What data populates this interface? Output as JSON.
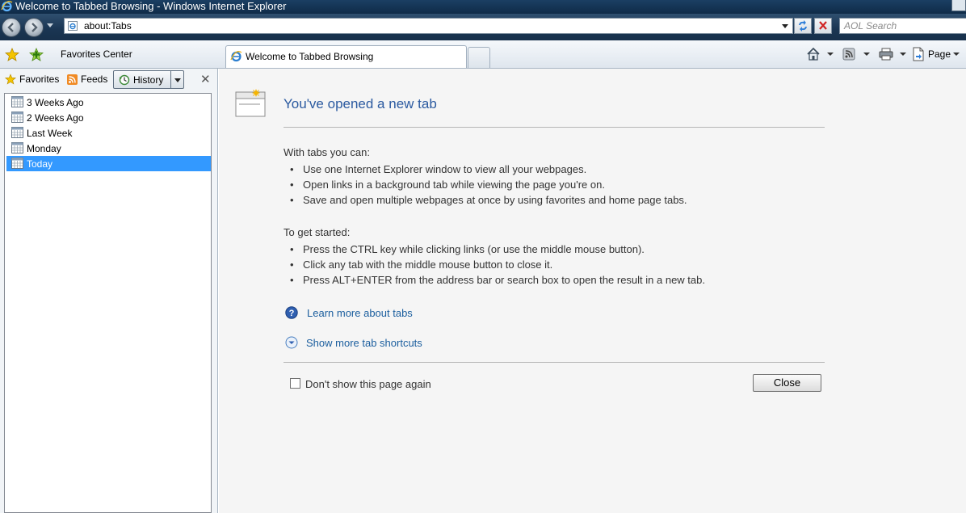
{
  "window": {
    "title": "Welcome to Tabbed Browsing - Windows Internet Explorer"
  },
  "navbar": {
    "address": "about:Tabs",
    "search_placeholder": "AOL Search"
  },
  "command_bar": {
    "favorites_center_label": "Favorites Center",
    "active_tab_label": "Welcome to Tabbed Browsing",
    "page_menu_label": "Page"
  },
  "favorites_pane": {
    "favorites_label": "Favorites",
    "feeds_label": "Feeds",
    "history_label": "History",
    "history_items": [
      "3 Weeks Ago",
      "2 Weeks Ago",
      "Last Week",
      "Monday",
      "Today"
    ],
    "selected_item": "Today"
  },
  "content": {
    "heading": "You've opened a new tab",
    "section1_title": "With tabs you can:",
    "section1_items": [
      "Use one Internet Explorer window to view all your webpages.",
      "Open links in a background tab while viewing the page you're on.",
      "Save and open multiple webpages at once by using favorites and home page tabs."
    ],
    "section2_title": "To get started:",
    "section2_items": [
      "Press the CTRL key while clicking links (or use the middle mouse button).",
      "Click any tab with the middle mouse button to close it.",
      "Press ALT+ENTER from the address bar or search box to open the result in a new tab."
    ],
    "learn_more_link": "Learn more about tabs",
    "shortcuts_link": "Show more tab shortcuts",
    "dont_show_label": "Don't show this page again",
    "close_button": "Close"
  },
  "colors": {
    "link": "#1b5e9e",
    "heading": "#2b5aa0",
    "selection": "#3399ff"
  }
}
